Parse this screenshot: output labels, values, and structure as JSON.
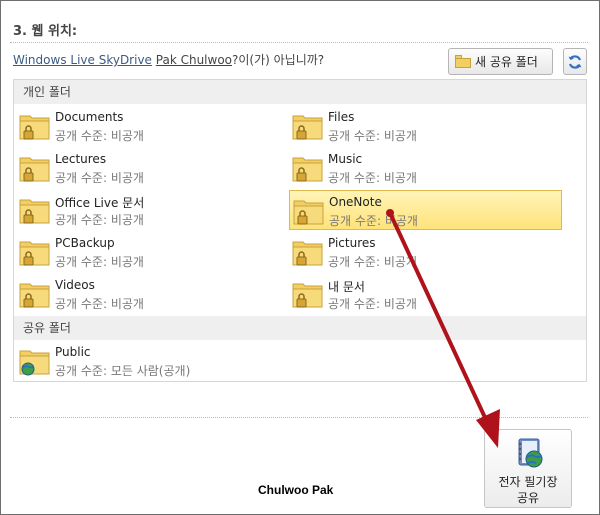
{
  "section": {
    "title": "3. 웹 위치:"
  },
  "location": {
    "service_link": "Windows Live SkyDrive",
    "user_link": "Pak Chulwoo",
    "question_suffix": "?이(가) 아닙니까?"
  },
  "toolbar": {
    "new_shared_folder_label": "새 공유 폴더",
    "refresh_icon": "refresh-icon"
  },
  "personal_group": {
    "header": "개인 폴더",
    "items": [
      {
        "name": "Documents",
        "access": "공개 수준: 비공개"
      },
      {
        "name": "Files",
        "access": "공개 수준: 비공개"
      },
      {
        "name": "Lectures",
        "access": "공개 수준: 비공개"
      },
      {
        "name": "Music",
        "access": "공개 수준: 비공개"
      },
      {
        "name": "Office Live 문서",
        "access": "공개 수준: 비공개"
      },
      {
        "name": "OneNote",
        "access": "공개 수준: 비공개",
        "selected": true
      },
      {
        "name": "PCBackup",
        "access": "공개 수준: 비공개"
      },
      {
        "name": "Pictures",
        "access": "공개 수준: 비공개"
      },
      {
        "name": "Videos",
        "access": "공개 수준: 비공개"
      },
      {
        "name": "내 문서",
        "access": "공개 수준: 비공개"
      }
    ]
  },
  "shared_group": {
    "header": "공유 폴더",
    "items": [
      {
        "name": "Public",
        "access": "공개 수준: 모든 사람(공개)"
      }
    ]
  },
  "footer": {
    "caption": "Chulwoo Pak",
    "share_button_line1": "전자 필기장",
    "share_button_line2": "공유"
  },
  "colors": {
    "folder_yellow": "#f2cf63",
    "selection": "#ffe37a",
    "annotation_arrow": "#b0121b",
    "link_blue": "#3b5b86"
  }
}
